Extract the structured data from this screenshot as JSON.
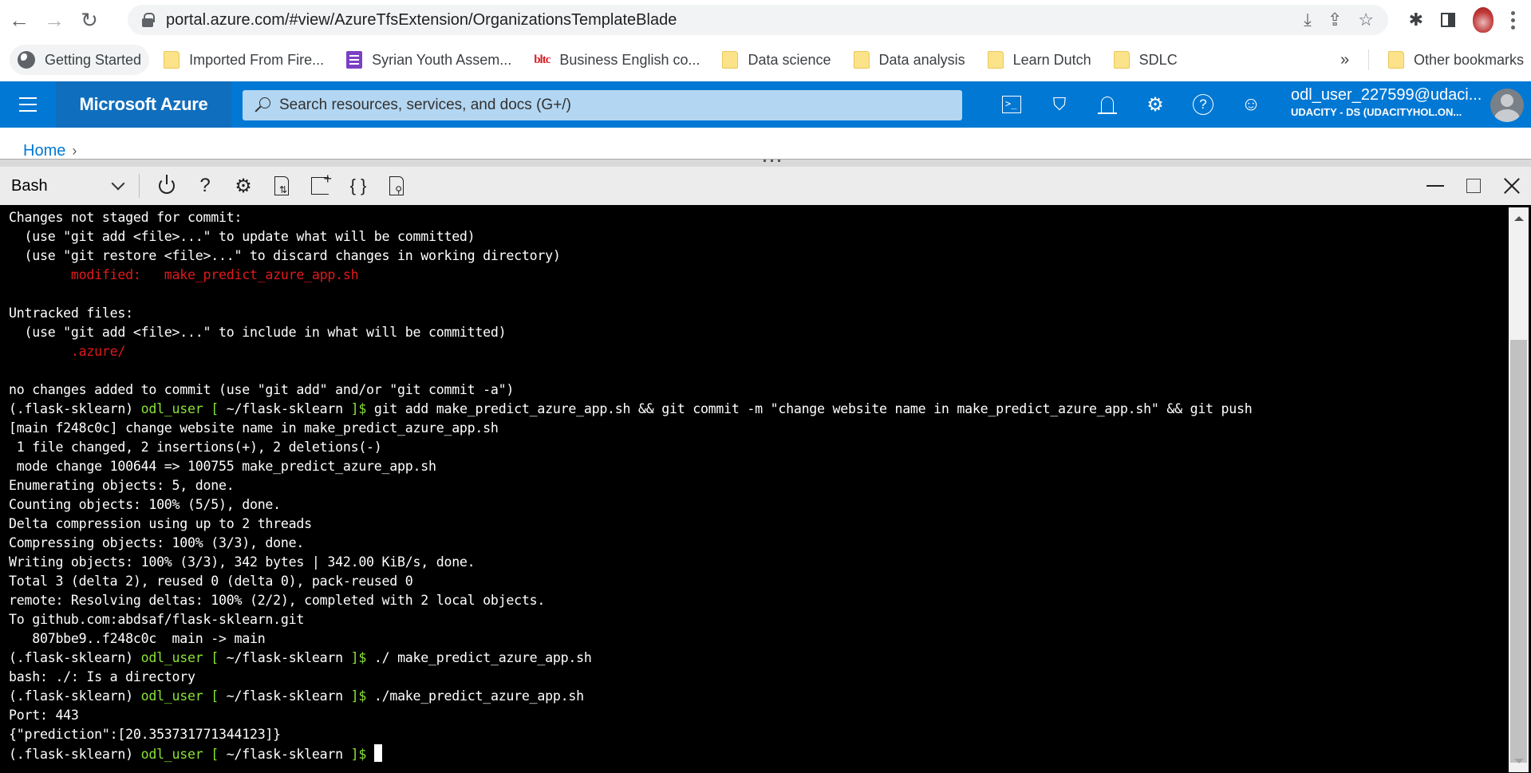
{
  "browser": {
    "url": "portal.azure.com/#view/AzureTfsExtension/OrganizationsTemplateBlade",
    "bookmarks": [
      {
        "label": "Getting Started",
        "icon": "globe-icon"
      },
      {
        "label": "Imported From Fire...",
        "icon": "folder-icon"
      },
      {
        "label": "Syrian Youth Assem...",
        "icon": "forms-icon"
      },
      {
        "label": "Business English co...",
        "icon": "bltc-icon",
        "icon_text": "bltc"
      },
      {
        "label": "Data science",
        "icon": "folder-icon"
      },
      {
        "label": "Data analysis",
        "icon": "folder-icon"
      },
      {
        "label": "Learn Dutch",
        "icon": "folder-icon"
      },
      {
        "label": "SDLC",
        "icon": "folder-icon"
      }
    ],
    "more_bookmarks": "»",
    "other_bookmarks": "Other bookmarks"
  },
  "azure": {
    "brand": "Microsoft Azure",
    "search_placeholder": "Search resources, services, and docs (G+/)",
    "user_name": "odl_user_227599@udaci...",
    "user_directory": "UDACITY - DS (UDACITYHOL.ON...",
    "breadcrumb": [
      "Home"
    ],
    "accent_color": "#0078d4"
  },
  "cloud_shell": {
    "shell_type": "Bash",
    "toolbar": {
      "restart_icon_glyph": "",
      "help_glyph": "?",
      "settings_glyph": "⚙",
      "upload_glyph": "⇅",
      "editor_glyph": "{ }"
    }
  },
  "terminal": {
    "lines": [
      [
        {
          "t": "Changes not staged for commit:"
        }
      ],
      [
        {
          "t": "  (use \"git add <file>...\" to update what will be committed)"
        }
      ],
      [
        {
          "t": "  (use \"git restore <file>...\" to discard changes in working directory)"
        }
      ],
      [
        {
          "t": "        modified:   make_predict_azure_app.sh",
          "c": "red"
        }
      ],
      [
        {
          "t": ""
        }
      ],
      [
        {
          "t": "Untracked files:"
        }
      ],
      [
        {
          "t": "  (use \"git add <file>...\" to include in what will be committed)"
        }
      ],
      [
        {
          "t": "        .azure/",
          "c": "red"
        }
      ],
      [
        {
          "t": ""
        }
      ],
      [
        {
          "t": "no changes added to commit (use \"git add\" and/or \"git commit -a\")"
        }
      ],
      [
        {
          "t": "(.flask-sklearn) "
        },
        {
          "t": "odl_user",
          "c": "green"
        },
        {
          "t": " [ ",
          "c": "green"
        },
        {
          "t": "~/flask-sklearn"
        },
        {
          "t": " ]$",
          "c": "green"
        },
        {
          "t": " git add make_predict_azure_app.sh && git commit -m \"change website name in make_predict_azure_app.sh\" && git push"
        }
      ],
      [
        {
          "t": "[main f248c0c] change website name in make_predict_azure_app.sh"
        }
      ],
      [
        {
          "t": " 1 file changed, 2 insertions(+), 2 deletions(-)"
        }
      ],
      [
        {
          "t": " mode change 100644 => 100755 make_predict_azure_app.sh"
        }
      ],
      [
        {
          "t": "Enumerating objects: 5, done."
        }
      ],
      [
        {
          "t": "Counting objects: 100% (5/5), done."
        }
      ],
      [
        {
          "t": "Delta compression using up to 2 threads"
        }
      ],
      [
        {
          "t": "Compressing objects: 100% (3/3), done."
        }
      ],
      [
        {
          "t": "Writing objects: 100% (3/3), 342 bytes | 342.00 KiB/s, done."
        }
      ],
      [
        {
          "t": "Total 3 (delta 2), reused 0 (delta 0), pack-reused 0"
        }
      ],
      [
        {
          "t": "remote: Resolving deltas: 100% (2/2), completed with 2 local objects."
        }
      ],
      [
        {
          "t": "To github.com:abdsaf/flask-sklearn.git"
        }
      ],
      [
        {
          "t": "   807bbe9..f248c0c  main -> main"
        }
      ],
      [
        {
          "t": "(.flask-sklearn) "
        },
        {
          "t": "odl_user",
          "c": "green"
        },
        {
          "t": " [ ",
          "c": "green"
        },
        {
          "t": "~/flask-sklearn"
        },
        {
          "t": " ]$",
          "c": "green"
        },
        {
          "t": " ./ make_predict_azure_app.sh"
        }
      ],
      [
        {
          "t": "bash: ./: Is a directory"
        }
      ],
      [
        {
          "t": "(.flask-sklearn) "
        },
        {
          "t": "odl_user",
          "c": "green"
        },
        {
          "t": " [ ",
          "c": "green"
        },
        {
          "t": "~/flask-sklearn"
        },
        {
          "t": " ]$",
          "c": "green"
        },
        {
          "t": " ./make_predict_azure_app.sh"
        }
      ],
      [
        {
          "t": "Port: 443"
        }
      ],
      [
        {
          "t": "{\"prediction\":[20.353731771344123]}"
        }
      ],
      [
        {
          "t": "(.flask-sklearn) "
        },
        {
          "t": "odl_user",
          "c": "green"
        },
        {
          "t": " [ ",
          "c": "green"
        },
        {
          "t": "~/flask-sklearn"
        },
        {
          "t": " ]$",
          "c": "green"
        },
        {
          "t": " "
        }
      ]
    ],
    "colors": {
      "background": "#000000",
      "text": "#ffffff",
      "error": "#e0191b",
      "prompt": "#8ae234"
    }
  }
}
